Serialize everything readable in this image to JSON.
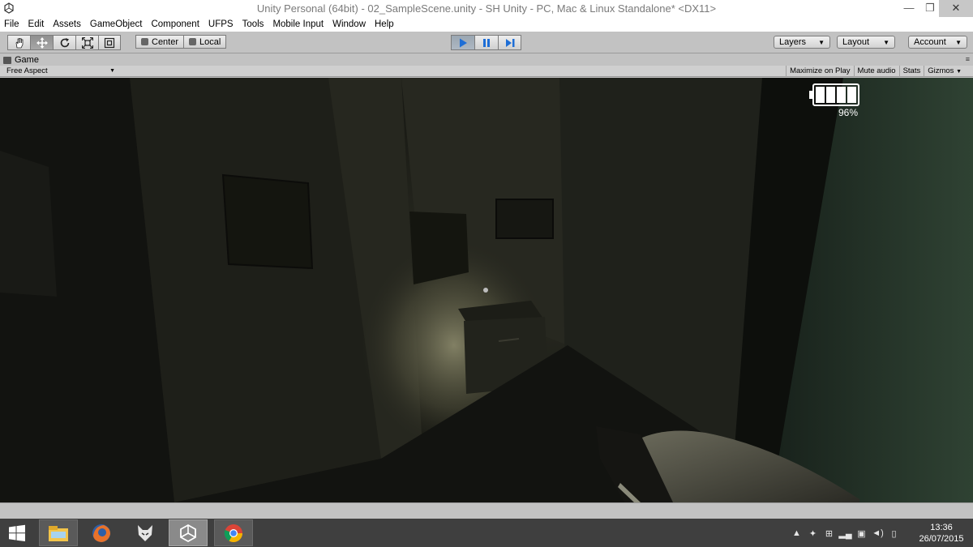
{
  "window": {
    "title": "Unity Personal (64bit) - 02_SampleScene.unity - SH Unity - PC, Mac & Linux Standalone* <DX11>",
    "minimize": "—",
    "maximize": "❐",
    "close": "✕"
  },
  "menu": {
    "items": [
      "File",
      "Edit",
      "Assets",
      "GameObject",
      "Component",
      "UFPS",
      "Tools",
      "Mobile Input",
      "Window",
      "Help"
    ]
  },
  "toolbar": {
    "tools": [
      "hand-icon",
      "move-icon",
      "rotate-icon",
      "scale-icon",
      "rect-icon"
    ],
    "active_tool": "move-icon",
    "pivot_label": "Center",
    "space_label": "Local",
    "play_active": true,
    "layers_label": "Layers",
    "layout_label": "Layout",
    "account_label": "Account"
  },
  "game_panel": {
    "tab_label": "Game",
    "aspect_label": "Free Aspect",
    "maximize_on_play": "Maximize on Play",
    "mute_audio": "Mute audio",
    "stats": "Stats",
    "gizmos": "Gizmos"
  },
  "hud": {
    "battery_percent_label": "96%",
    "battery_level": 0.96,
    "battery_cells_filled": 4
  },
  "taskbar": {
    "apps": [
      "explorer-icon",
      "firefox-icon",
      "foobar-icon",
      "unity-icon",
      "chrome-icon"
    ],
    "active_app": "unity-icon",
    "clock_time": "13:36",
    "clock_date": "26/07/2015"
  },
  "colors": {
    "editor_gray": "#c2c2c2",
    "play_blue": "#1e6ed6",
    "taskbar": "#3f3f3f"
  }
}
